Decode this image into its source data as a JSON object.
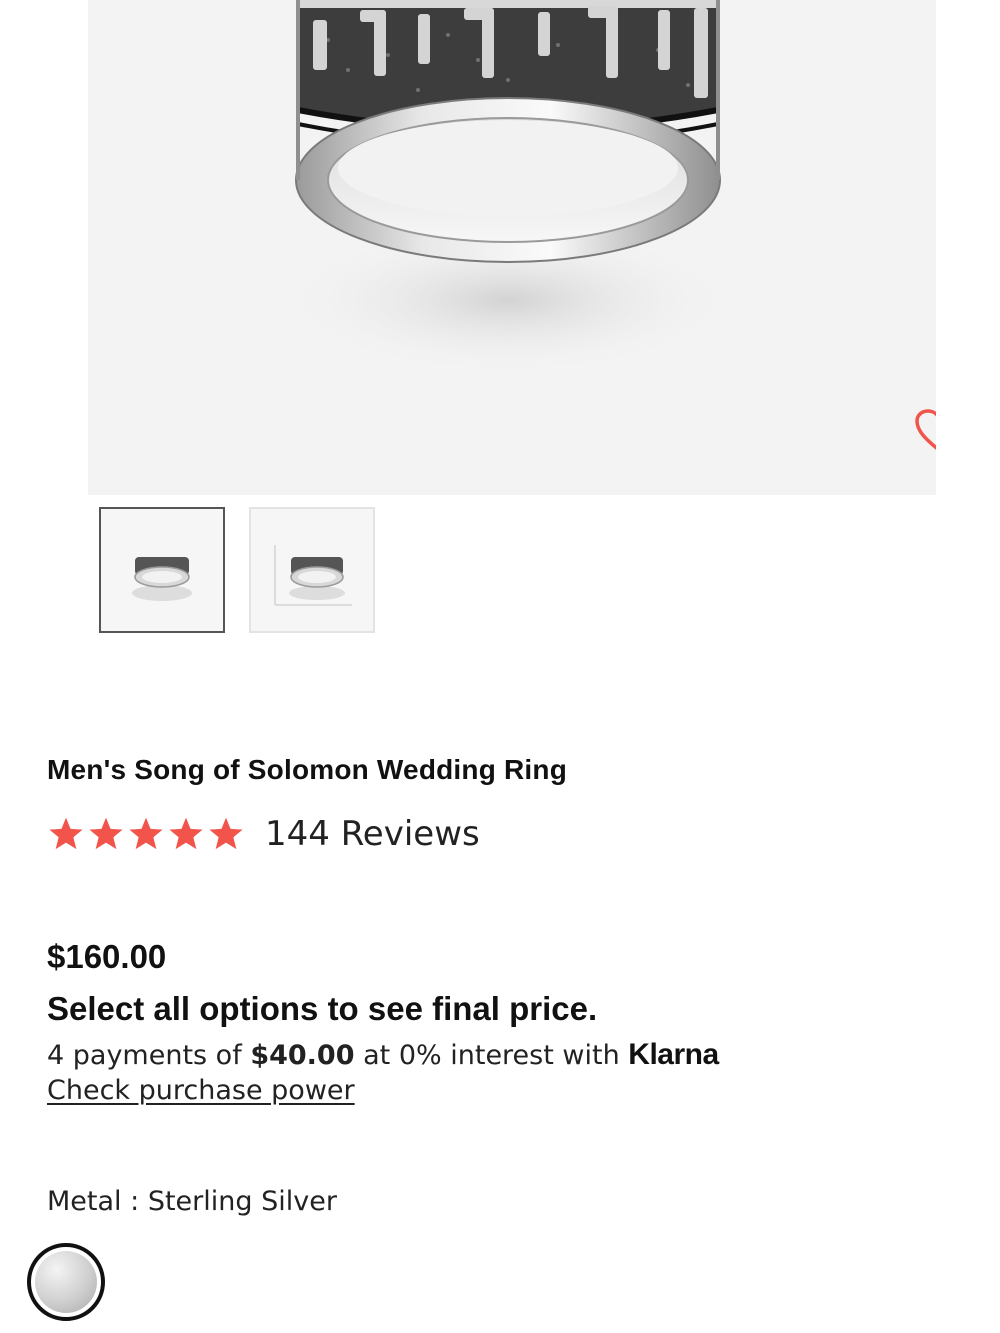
{
  "product": {
    "title": "Men's Song of Solomon Wedding Ring",
    "rating": 5,
    "max_rating": 5,
    "reviews_label": "144 Reviews",
    "price": "$160.00",
    "price_note": "Select all options to see final price.",
    "klarna": {
      "prefix": "4 payments of",
      "amount": "$40.00",
      "suffix": "at 0% interest with",
      "brand": "Klarna",
      "link": "Check purchase power"
    },
    "metal": {
      "label": "Metal :",
      "value": "Sterling Silver"
    }
  },
  "gallery": {
    "thumbnail_count": 2,
    "active_index": 0
  },
  "colors": {
    "accent": "#f2544b",
    "hero_bg": "#f3f3f3",
    "text": "#111111"
  },
  "icons": {
    "favorite": "heart-outline-icon",
    "rating": "star-icon"
  }
}
